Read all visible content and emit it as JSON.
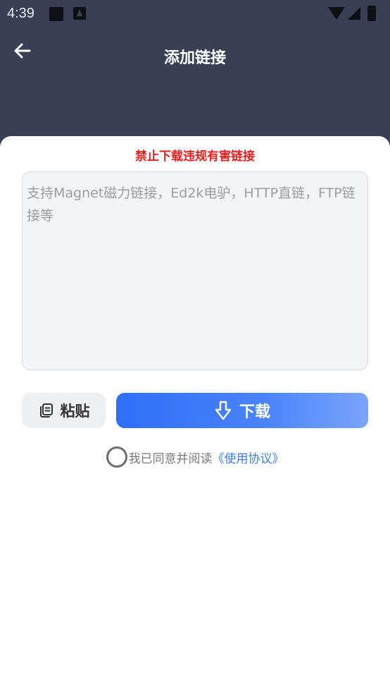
{
  "status_bar": {
    "time": "4:39"
  },
  "header": {
    "title": "添加链接",
    "back_icon": "arrow-left-icon"
  },
  "card": {
    "warning": "禁止下载违规有害链接",
    "input": {
      "value": "",
      "placeholder": "支持Magnet磁力链接，Ed2k电驴，HTTP直链，FTP链接等"
    },
    "paste_button": {
      "label": "粘贴",
      "icon": "paste-icon"
    },
    "download_button": {
      "label": "下载",
      "icon": "download-icon"
    },
    "agreement": {
      "checked": false,
      "text": "我已同意并阅读",
      "link": "《使用协议》"
    }
  },
  "colors": {
    "header_bg": "#3b3f55",
    "warning": "#e8201f",
    "accent": "#2e6ff7",
    "link": "#3a7ef0"
  }
}
